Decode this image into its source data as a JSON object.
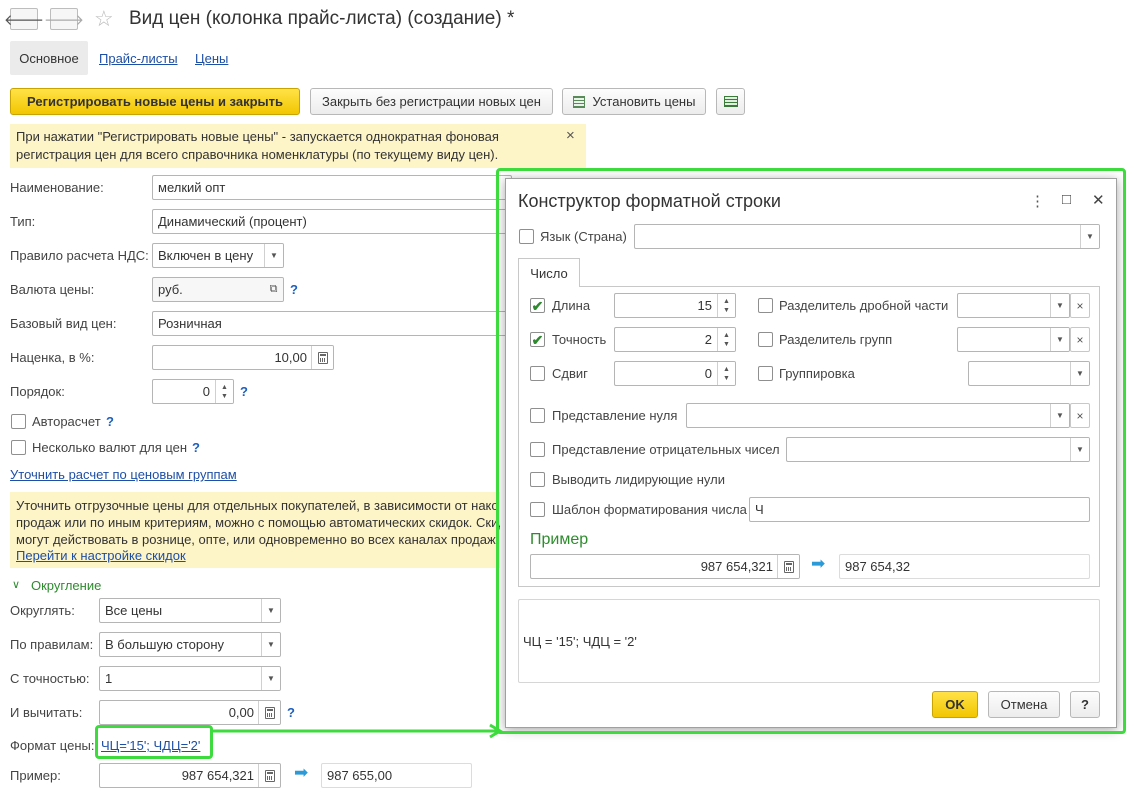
{
  "window": {
    "title": "Вид цен (колонка прайс-листа) (создание) *",
    "back_icon": "arrow-left",
    "forward_icon": "arrow-right",
    "favorite_icon": "star"
  },
  "tabs": [
    "Основное",
    "Прайс-листы",
    "Цены"
  ],
  "toolbar": {
    "register_close": "Регистрировать новые цены и закрыть",
    "close_no_register": "Закрыть без регистрации новых цен",
    "set_prices": "Установить цены"
  },
  "info1": {
    "line1": "При нажатии \"Регистрировать новые цены\" - запускается однократная фоновая",
    "line2": "регистрация цен для всего справочника номенклатуры (по текущему виду цен).",
    "close": "×"
  },
  "form": {
    "name_label": "Наименование:",
    "name_value": "мелкий опт",
    "type_label": "Тип:",
    "type_value": "Динамический (процент)",
    "vat_label": "Правило расчета НДС:",
    "vat_value": "Включен в цену",
    "currency_label": "Валюта цены:",
    "currency_value": "руб.",
    "base_label": "Базовый вид цен:",
    "base_value": "Розничная",
    "markup_label": "Наценка, в %:",
    "markup_value": "10,00",
    "order_label": "Порядок:",
    "order_value": "0",
    "autocalc_label": "Авторасчет",
    "multicurrency_label": "Несколько валют для цен",
    "refine_link": "Уточнить расчет по ценовым группам",
    "help": "?"
  },
  "info2": {
    "line1": "Уточнить отгрузочные цены для отдельных покупателей, в зависимости от нако",
    "line2": "продаж или по иным критериям, можно с помощью автоматических скидок. Скид",
    "line3": "могут действовать в рознице, опте, или одновременно во всех каналах продаж",
    "link": "Перейти к настройке скидок"
  },
  "rounding": {
    "header": "Округление",
    "round_label": "Округлять:",
    "round_value": "Все цены",
    "rule_label": "По правилам:",
    "rule_value": "В большую сторону",
    "precision_label": "С точностью:",
    "precision_value": "1",
    "subtract_label": "И вычитать:",
    "subtract_value": "0,00",
    "format_label": "Формат цены:",
    "format_value": "ЧЦ='15'; ЧДЦ='2'",
    "example_label": "Пример:",
    "example_input": "987 654,321",
    "example_result": "987 655,00"
  },
  "dialog": {
    "title": "Конструктор форматной строки",
    "language_label": "Язык (Страна)",
    "tab": "Число",
    "length_label": "Длина",
    "length_value": "15",
    "length_checked": true,
    "precision_label": "Точность",
    "precision_value": "2",
    "precision_checked": true,
    "shift_label": "Сдвиг",
    "shift_value": "0",
    "shift_checked": false,
    "fraction_sep_label": "Разделитель дробной части",
    "group_sep_label": "Разделитель групп",
    "grouping_label": "Группировка",
    "zero_label": "Представление нуля",
    "negative_label": "Представление отрицательных чисел",
    "leading_zeros_label": "Выводить лидирующие нули",
    "template_label": "Шаблон форматирования числа",
    "template_value": "Ч",
    "example_header": "Пример",
    "example_input": "987 654,321",
    "example_result": "987 654,32",
    "result_string": "ЧЦ = '15'; ЧДЦ = '2'",
    "ok": "OK",
    "cancel": "Отмена",
    "help": "?",
    "menu_icon": "⋮",
    "maximize_icon": "□",
    "close_icon": "✕"
  },
  "colors": {
    "highlight_frame": "#3ddb3d",
    "info_bg": "#fdf4c8",
    "primary_button": "#f2c600",
    "link": "#1e4fa6"
  }
}
